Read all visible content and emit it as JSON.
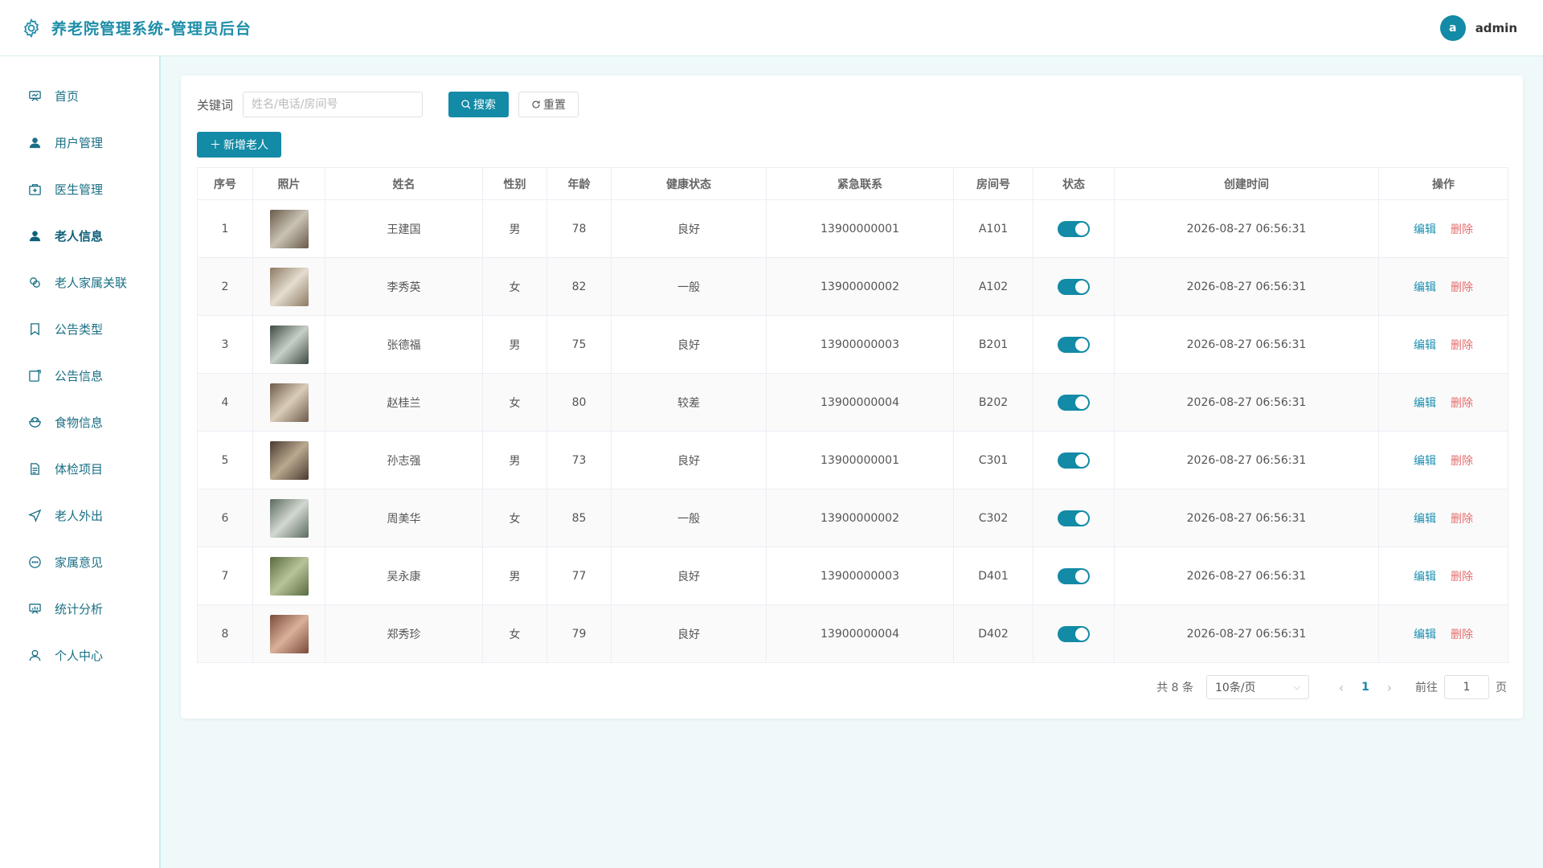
{
  "header": {
    "title": "养老院管理系统-管理员后台",
    "avatar_letter": "a",
    "username": "admin"
  },
  "sidebar": {
    "items": [
      {
        "label": "首页",
        "icon": "home-icon"
      },
      {
        "label": "用户管理",
        "icon": "user-icon"
      },
      {
        "label": "医生管理",
        "icon": "doctor-icon"
      },
      {
        "label": "老人信息",
        "icon": "elder-icon"
      },
      {
        "label": "老人家属关联",
        "icon": "link-icon"
      },
      {
        "label": "公告类型",
        "icon": "bookmark-icon"
      },
      {
        "label": "公告信息",
        "icon": "notice-icon"
      },
      {
        "label": "食物信息",
        "icon": "food-icon"
      },
      {
        "label": "体检项目",
        "icon": "document-icon"
      },
      {
        "label": "老人外出",
        "icon": "send-icon"
      },
      {
        "label": "家属意见",
        "icon": "chat-icon"
      },
      {
        "label": "统计分析",
        "icon": "chart-icon"
      },
      {
        "label": "个人中心",
        "icon": "person-icon"
      }
    ]
  },
  "toolbar": {
    "keyword_label": "关键词",
    "search_placeholder": "姓名/电话/房间号",
    "search_label": "搜索",
    "reset_label": "重置",
    "add_label": "新增老人"
  },
  "table": {
    "headers": [
      "序号",
      "照片",
      "姓名",
      "性别",
      "年龄",
      "健康状态",
      "紧急联系",
      "房间号",
      "状态",
      "创建时间",
      "操作"
    ],
    "rows": [
      {
        "no": "1",
        "name": "王建国",
        "gender": "男",
        "age": "78",
        "health": "良好",
        "contact": "13900000001",
        "room": "A101",
        "created": "2026-08-27 06:56:31"
      },
      {
        "no": "2",
        "name": "李秀英",
        "gender": "女",
        "age": "82",
        "health": "一般",
        "contact": "13900000002",
        "room": "A102",
        "created": "2026-08-27 06:56:31"
      },
      {
        "no": "3",
        "name": "张德福",
        "gender": "男",
        "age": "75",
        "health": "良好",
        "contact": "13900000003",
        "room": "B201",
        "created": "2026-08-27 06:56:31"
      },
      {
        "no": "4",
        "name": "赵桂兰",
        "gender": "女",
        "age": "80",
        "health": "较差",
        "contact": "13900000004",
        "room": "B202",
        "created": "2026-08-27 06:56:31"
      },
      {
        "no": "5",
        "name": "孙志强",
        "gender": "男",
        "age": "73",
        "health": "良好",
        "contact": "13900000001",
        "room": "C301",
        "created": "2026-08-27 06:56:31"
      },
      {
        "no": "6",
        "name": "周美华",
        "gender": "女",
        "age": "85",
        "health": "一般",
        "contact": "13900000002",
        "room": "C302",
        "created": "2026-08-27 06:56:31"
      },
      {
        "no": "7",
        "name": "吴永康",
        "gender": "男",
        "age": "77",
        "health": "良好",
        "contact": "13900000003",
        "room": "D401",
        "created": "2026-08-27 06:56:31"
      },
      {
        "no": "8",
        "name": "郑秀珍",
        "gender": "女",
        "age": "79",
        "health": "良好",
        "contact": "13900000004",
        "room": "D402",
        "created": "2026-08-27 06:56:31"
      }
    ],
    "edit_label": "编辑",
    "delete_label": "删除"
  },
  "pager": {
    "total": "共 8 条",
    "page_size": "10条/页",
    "current": "1",
    "goto_label": "前往",
    "goto_value": "1",
    "page_suffix": "页"
  },
  "colors": {
    "accent": "#138aa6",
    "danger": "#e56c6c"
  }
}
